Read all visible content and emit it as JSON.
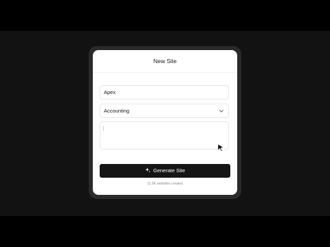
{
  "dialog": {
    "title": "New Site"
  },
  "form": {
    "name_value": "Apex",
    "category_value": "Accounting",
    "description_value": ""
  },
  "button": {
    "generate_label": "Generate Site"
  },
  "footer": {
    "stat_text": "11.5K websites created"
  },
  "icons": {
    "select": "chevron-down-icon",
    "button": "sparkle-icon",
    "pointer": "cursor-pointer-icon"
  },
  "colors": {
    "page_background": "#121212",
    "card_background": "#ffffff",
    "button_background": "#151515",
    "button_text": "#ffffff"
  }
}
